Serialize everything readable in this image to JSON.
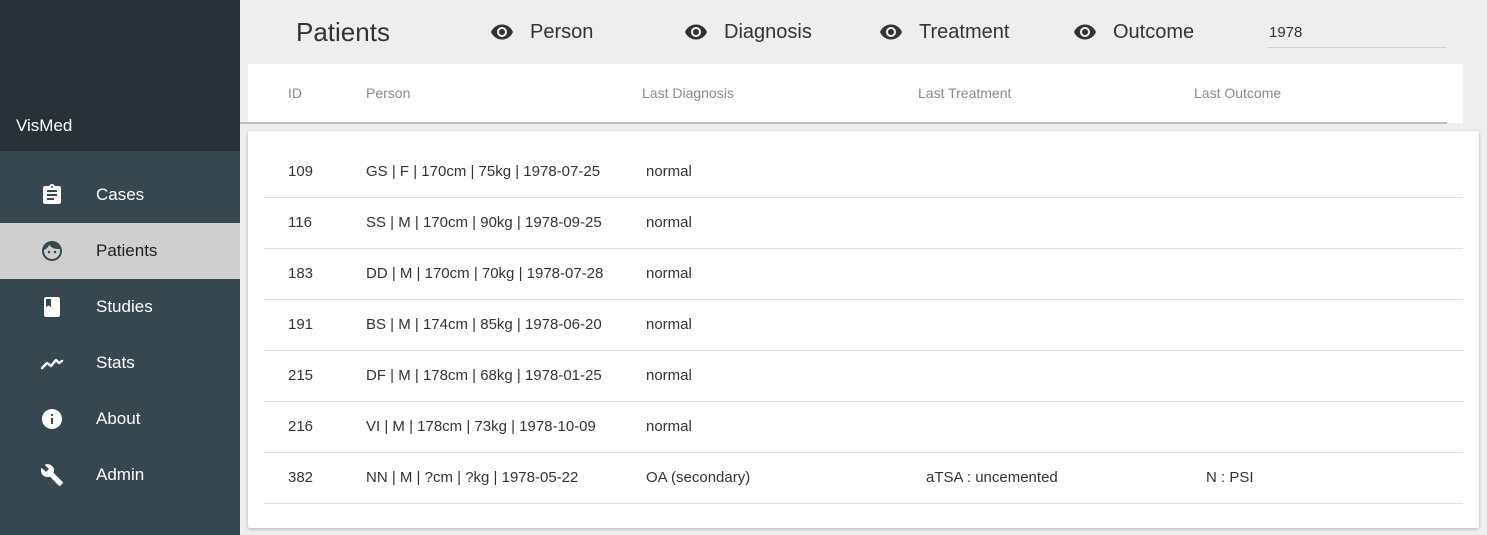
{
  "sidebar": {
    "brand": "VisMed",
    "items": [
      {
        "label": "Cases",
        "icon": "clipboard-icon"
      },
      {
        "label": "Patients",
        "icon": "face-icon"
      },
      {
        "label": "Studies",
        "icon": "book-icon"
      },
      {
        "label": "Stats",
        "icon": "trending-icon"
      },
      {
        "label": "About",
        "icon": "info-icon"
      },
      {
        "label": "Admin",
        "icon": "wrench-icon"
      }
    ],
    "active": "Patients"
  },
  "header": {
    "title": "Patients",
    "toggles": [
      {
        "label": "Person",
        "icon": "eye-icon"
      },
      {
        "label": "Diagnosis",
        "icon": "eye-icon"
      },
      {
        "label": "Treatment",
        "icon": "eye-icon"
      },
      {
        "label": "Outcome",
        "icon": "eye-icon"
      }
    ],
    "search_value": "1978"
  },
  "table": {
    "columns": [
      "ID",
      "Person",
      "Last Diagnosis",
      "Last Treatment",
      "Last Outcome"
    ],
    "rows": [
      {
        "id": "109",
        "person": "GS | F | 170cm | 75kg | 1978-07-25",
        "diagnosis": "normal",
        "treatment": "",
        "outcome": ""
      },
      {
        "id": "116",
        "person": "SS | M | 170cm | 90kg | 1978-09-25",
        "diagnosis": "normal",
        "treatment": "",
        "outcome": ""
      },
      {
        "id": "183",
        "person": "DD | M | 170cm | 70kg | 1978-07-28",
        "diagnosis": "normal",
        "treatment": "",
        "outcome": ""
      },
      {
        "id": "191",
        "person": "BS | M | 174cm | 85kg | 1978-06-20",
        "diagnosis": "normal",
        "treatment": "",
        "outcome": ""
      },
      {
        "id": "215",
        "person": "DF | M | 178cm | 68kg | 1978-01-25",
        "diagnosis": "normal",
        "treatment": "",
        "outcome": ""
      },
      {
        "id": "216",
        "person": "VI | M | 178cm | 73kg | 1978-10-09",
        "diagnosis": "normal",
        "treatment": "",
        "outcome": ""
      },
      {
        "id": "382",
        "person": "NN | M | ?cm | ?kg | 1978-05-22",
        "diagnosis": "OA (secondary)",
        "treatment": "aTSA : uncemented",
        "outcome": "N : PSI"
      }
    ]
  },
  "colors": {
    "sidebar_bg": "#37474f",
    "sidebar_head_bg": "#263238",
    "active_item_bg": "#cfcfcf"
  }
}
